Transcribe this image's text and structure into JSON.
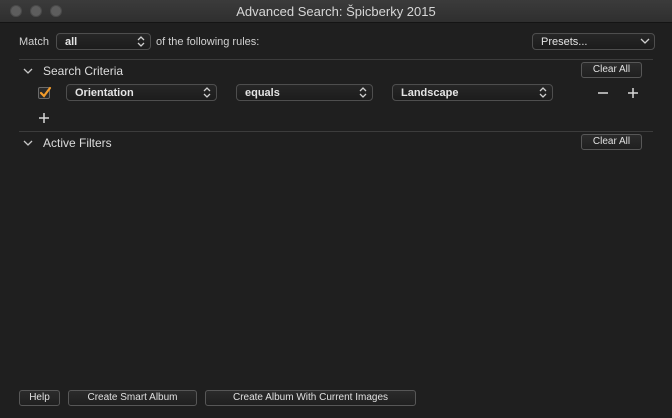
{
  "window": {
    "title": "Advanced Search: Špicberky 2015"
  },
  "match": {
    "label": "Match",
    "value": "all",
    "suffix": "of the following rules:",
    "presets_label": "Presets..."
  },
  "search_criteria": {
    "title": "Search Criteria",
    "clear_label": "Clear All",
    "rule": {
      "checked": true,
      "field": "Orientation",
      "operator": "equals",
      "value": "Landscape"
    }
  },
  "active_filters": {
    "title": "Active Filters",
    "clear_label": "Clear All"
  },
  "footer": {
    "help_label": "Help",
    "smart_album_label": "Create Smart Album",
    "album_current_label": "Create Album With Current Images"
  },
  "colors": {
    "checkbox_accent": "#f39c2b",
    "background": "#1f1f1f"
  }
}
